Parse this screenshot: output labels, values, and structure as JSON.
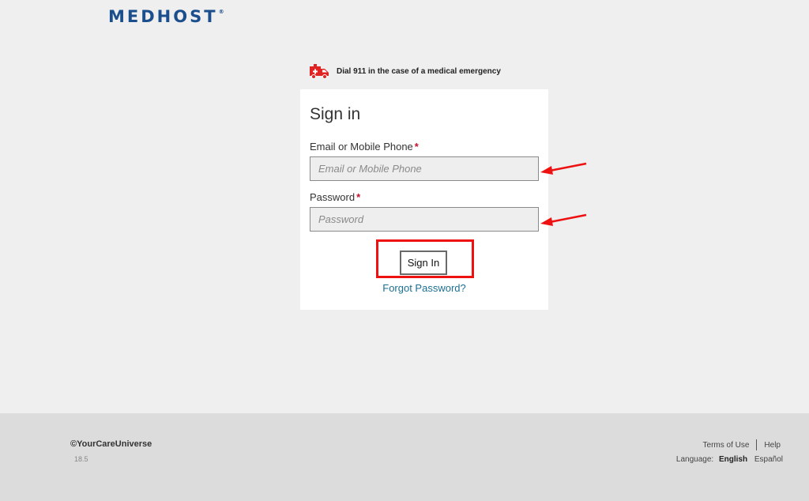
{
  "logo": {
    "text": "MEDHOST",
    "mark": "®"
  },
  "emergency": {
    "icon": "ambulance-icon",
    "text": "Dial 911 in the case of a medical emergency"
  },
  "signin": {
    "title": "Sign in",
    "email_label": "Email or Mobile Phone",
    "email_placeholder": "Email or Mobile Phone",
    "email_value": "",
    "password_label": "Password",
    "password_placeholder": "Password",
    "password_value": "",
    "required_mark": "*",
    "button_label": "Sign In",
    "forgot_link": "Forgot Password?"
  },
  "annotations": {
    "highlight_color": "#ee1111",
    "arrow_color": "#ee1111"
  },
  "footer": {
    "copyright": "©YourCareUniverse",
    "version": "18.5",
    "terms": "Terms of Use",
    "help": "Help",
    "language_label": "Language:",
    "language_current": "English",
    "language_alt": "Español"
  },
  "colors": {
    "brand": "#1a4e8c",
    "link": "#1d6f91",
    "required": "#c8102e",
    "emergency": "#e02424"
  }
}
